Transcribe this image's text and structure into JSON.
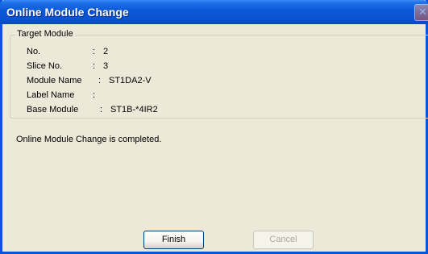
{
  "window": {
    "title": "Online Module Change",
    "close_glyph": "✕"
  },
  "target_module": {
    "legend": "Target Module",
    "fields": [
      {
        "label": "No.",
        "value": "2"
      },
      {
        "label": "Slice No.",
        "value": "3"
      },
      {
        "label": "Module Name",
        "value": "ST1DA2-V"
      },
      {
        "label": "Label Name",
        "value": ""
      },
      {
        "label": "Base Module",
        "value": "ST1B-*4IR2"
      }
    ]
  },
  "message": "Online Module Change is completed.",
  "buttons": {
    "finish_label": "Finish",
    "cancel_label": "Cancel",
    "cancel_enabled": false
  },
  "colors": {
    "titlebar": "#0a58d8",
    "dialog_bg": "#ece9d8",
    "disabled_text": "#aca899"
  }
}
